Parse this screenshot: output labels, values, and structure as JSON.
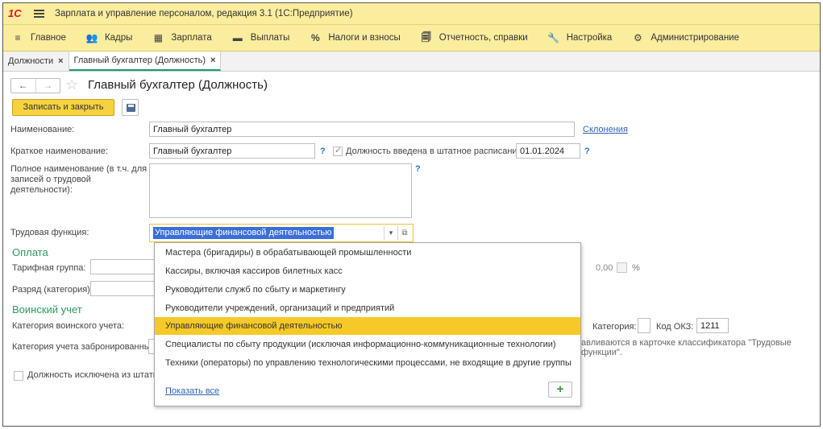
{
  "window": {
    "logo": "1С",
    "title": "Зарплата и управление персоналом, редакция 3.1  (1С:Предприятие)"
  },
  "menu": {
    "items": [
      {
        "icon": "≡",
        "label": "Главное"
      },
      {
        "icon": "👥",
        "label": "Кадры"
      },
      {
        "icon": "▦",
        "label": "Зарплата"
      },
      {
        "icon": "▬",
        "label": "Выплаты"
      },
      {
        "icon": "%",
        "label": "Налоги и взносы"
      },
      {
        "icon": "🗐",
        "label": "Отчетность, справки"
      },
      {
        "icon": "🔧",
        "label": "Настройка"
      },
      {
        "icon": "⚙",
        "label": "Администрирование"
      }
    ]
  },
  "tabs": [
    {
      "label": "Должности",
      "close": "×"
    },
    {
      "label": "Главный бухгалтер (Должность)",
      "close": "×"
    }
  ],
  "form": {
    "nav_back": "←",
    "nav_forward": "→",
    "title": "Главный бухгалтер (Должность)",
    "save_close_label": "Записать и закрыть",
    "name_label": "Наименование:",
    "name_value": "Главный бухгалтер",
    "declensions_link": "Склонения",
    "short_name_label": "Краткое наименование:",
    "short_name_value": "Главный бухгалтер",
    "help": "?",
    "staff_schedule_label": "Должность введена в штатное расписание",
    "staff_schedule_date": "01.01.2024",
    "full_name_label": "Полное наименование (в т.ч. для записей о трудовой деятельности):",
    "labor_function_label": "Трудовая функция:",
    "labor_function_value": "Управляющие финансовой деятельностью",
    "payment_section": "Оплата",
    "tariff_group_label": "Тарифная группа:",
    "rank_label": "Разряд (категория):",
    "percent_value": "0,00",
    "percent_sign": "%",
    "military_section": "Воинский учет",
    "military_category_label": "Категория воинского учета:",
    "category_label": "Категория:",
    "okz_label": "Код ОКЗ:",
    "okz_value": "1211",
    "reserved_category_label": "Категория учета забронированных:",
    "classifier_note": "авливаются в карточке классификатора \"Трудовые функции\".",
    "excluded_label": "Должность исключена из штатно"
  },
  "dropdown": {
    "options": [
      "Мастера (бригадиры) в обрабатывающей промышленности",
      "Кассиры, включая кассиров билетных касс",
      "Руководители служб по сбыту и маркетингу",
      "Руководители учреждений, организаций и предприятий",
      "Управляющие финансовой деятельностью",
      "Специалисты по сбыту продукции (исключая информационно-коммуникационные технологии)",
      "Техники (операторы) по управлению технологическими процессами, не входящие в другие группы"
    ],
    "selected_index": 4,
    "show_all": "Показать все",
    "add": "+"
  }
}
